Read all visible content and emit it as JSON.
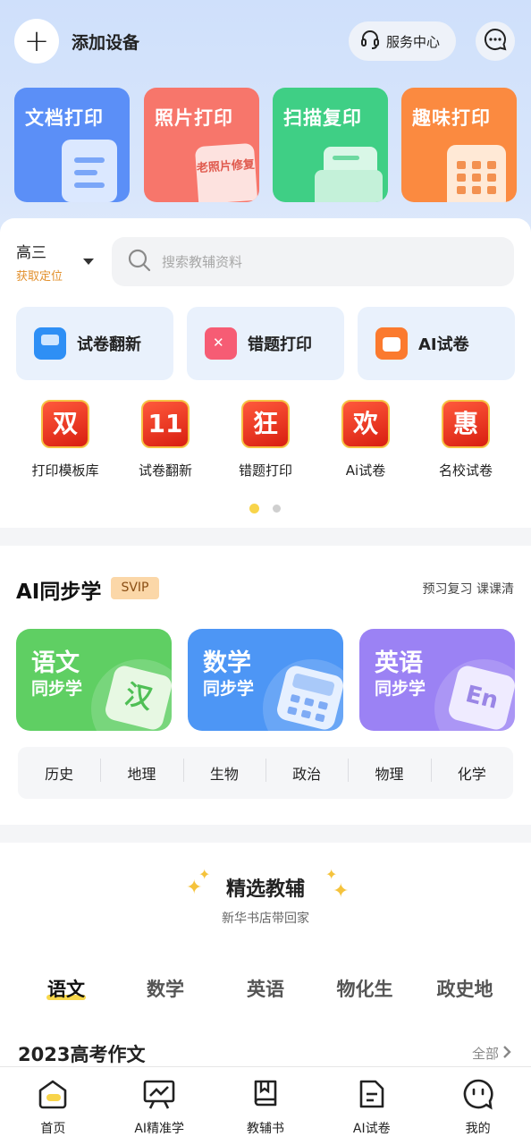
{
  "header": {
    "add_label": "添加设备",
    "service_label": "服务中心"
  },
  "print_cards": [
    {
      "label": "文档打印",
      "color": "#5b8ff7"
    },
    {
      "label": "照片打印",
      "color": "#f7766b",
      "art_text": "老照片修复"
    },
    {
      "label": "扫描复印",
      "color": "#3fcf85"
    },
    {
      "label": "趣味打印",
      "color": "#fb8a40"
    }
  ],
  "grade": {
    "value": "高三",
    "locate": "获取定位"
  },
  "search": {
    "placeholder": "搜索教辅资料"
  },
  "tools": [
    {
      "label": "试卷翻新",
      "icon": "exam-refresh-icon"
    },
    {
      "label": "错题打印",
      "icon": "wrong-question-icon"
    },
    {
      "label": "AI试卷",
      "icon": "ai-paper-icon"
    }
  ],
  "promos": [
    {
      "glyph": "双",
      "label": "打印模板库"
    },
    {
      "glyph": "11",
      "label": "试卷翻新"
    },
    {
      "glyph": "狂",
      "label": "错题打印"
    },
    {
      "glyph": "欢",
      "label": "Ai试卷"
    },
    {
      "glyph": "惠",
      "label": "名校试卷"
    }
  ],
  "ai_section": {
    "title": "AI同步学",
    "badge": "SVIP",
    "subtitle": "预习复习 课课清",
    "cards": [
      {
        "name": "语文",
        "sub": "同步学",
        "art": "汉",
        "color": "#5fcf63"
      },
      {
        "name": "数学",
        "sub": "同步学",
        "color": "#4d96f5"
      },
      {
        "name": "英语",
        "sub": "同步学",
        "art": "En",
        "color": "#9b82f4"
      }
    ],
    "subjects": [
      "历史",
      "地理",
      "生物",
      "政治",
      "物理",
      "化学"
    ]
  },
  "featured": {
    "title": "精选教辅",
    "subtitle": "新华书店带回家",
    "tabs": [
      "语文",
      "数学",
      "英语",
      "物化生",
      "政史地"
    ],
    "active_tab": "语文",
    "section_title": "2023高考作文",
    "all_label": "全部"
  },
  "bottom_nav": [
    {
      "label": "首页",
      "icon": "home-icon"
    },
    {
      "label": "AI精准学",
      "icon": "chart-board-icon"
    },
    {
      "label": "教辅书",
      "icon": "book-icon"
    },
    {
      "label": "AI试卷",
      "icon": "document-icon"
    },
    {
      "label": "我的",
      "icon": "profile-face-icon"
    }
  ]
}
